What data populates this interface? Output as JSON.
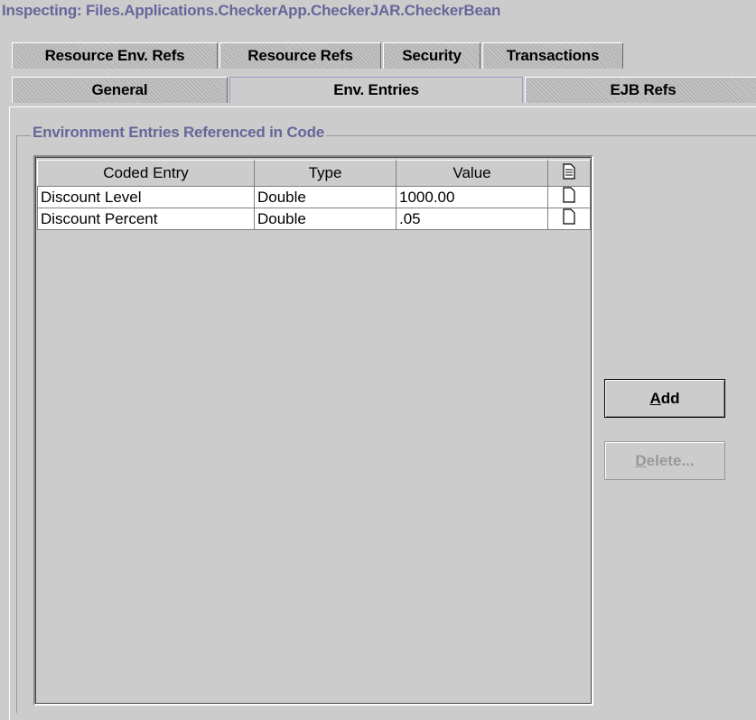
{
  "window": {
    "title": "Inspecting: Files.Applications.CheckerApp.CheckerJAR.CheckerBean"
  },
  "tabs_row1": [
    {
      "label": "Resource Env. Refs"
    },
    {
      "label": "Resource Refs"
    },
    {
      "label": "Security"
    },
    {
      "label": "Transactions"
    }
  ],
  "tabs_row2": [
    {
      "label": "General"
    },
    {
      "label": "Env. Entries",
      "selected": true
    },
    {
      "label": "EJB Refs"
    }
  ],
  "group": {
    "title": "Environment Entries Referenced in Code"
  },
  "table": {
    "columns": [
      "Coded Entry",
      "Type",
      "Value"
    ],
    "rows": [
      {
        "coded_entry": "Discount Level",
        "type": "Double",
        "value": "1000.00"
      },
      {
        "coded_entry": "Discount Percent",
        "type": "Double",
        "value": ".05"
      }
    ]
  },
  "buttons": {
    "add": {
      "mnemonic": "A",
      "rest": "dd",
      "enabled": true
    },
    "delete": {
      "mnemonic": "D",
      "rest": "elete...",
      "enabled": false
    }
  },
  "colors": {
    "title_text": "#66669a",
    "panel_bg": "#cccccc",
    "selected_tab_border": "#9999cc"
  },
  "icons": {
    "header_icon": "document-lines-icon",
    "row_icon": "document-icon"
  }
}
